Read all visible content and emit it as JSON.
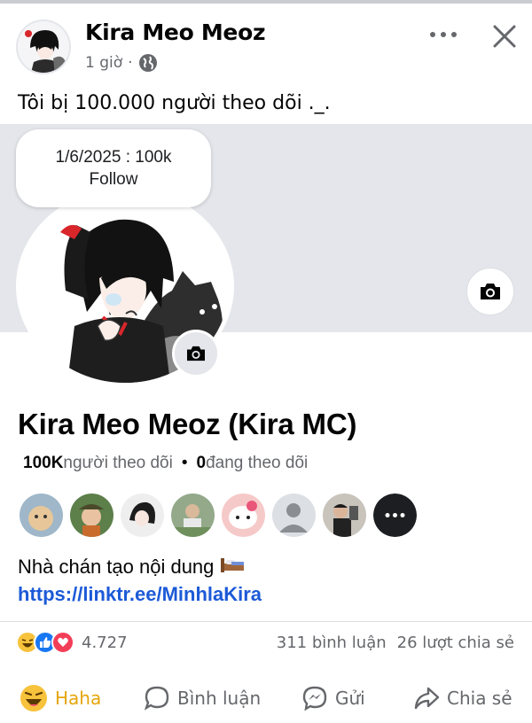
{
  "post": {
    "author": "Kira Meo Meoz",
    "time": "1 giờ",
    "separator": "·",
    "text": "Tôi bị 100.000 người theo dõi ._."
  },
  "profile_card": {
    "note_line1": "1/6/2025 : 100k",
    "note_line2": "Follow",
    "name": "Kira Meo Meoz (Kira MC)",
    "followers_count": "100K",
    "followers_label": " người theo dõi",
    "dot": "•",
    "following_count": "0",
    "following_label": " đang theo dõi",
    "bio": "Nhà chán tạo nội dung",
    "link": "https://linktr.ee/MinhlaKira"
  },
  "reactions": {
    "count": "4.727",
    "comments": "311 bình luận",
    "shares": "26 lượt chia sẻ"
  },
  "actions": {
    "haha": "Haha",
    "comment": "Bình luận",
    "send": "Gửi",
    "share": "Chia sẻ"
  },
  "icons": [
    "more-icon",
    "close-icon",
    "globe-icon",
    "camera-icon",
    "bed-emoji",
    "haha-icon",
    "like-icon",
    "love-icon",
    "comment-icon",
    "messenger-icon",
    "share-icon"
  ],
  "colors": {
    "link": "#1c5ad7",
    "haha": "#e5a50a",
    "like": "#1877f2",
    "love": "#f33e58",
    "muted": "#65676b"
  }
}
